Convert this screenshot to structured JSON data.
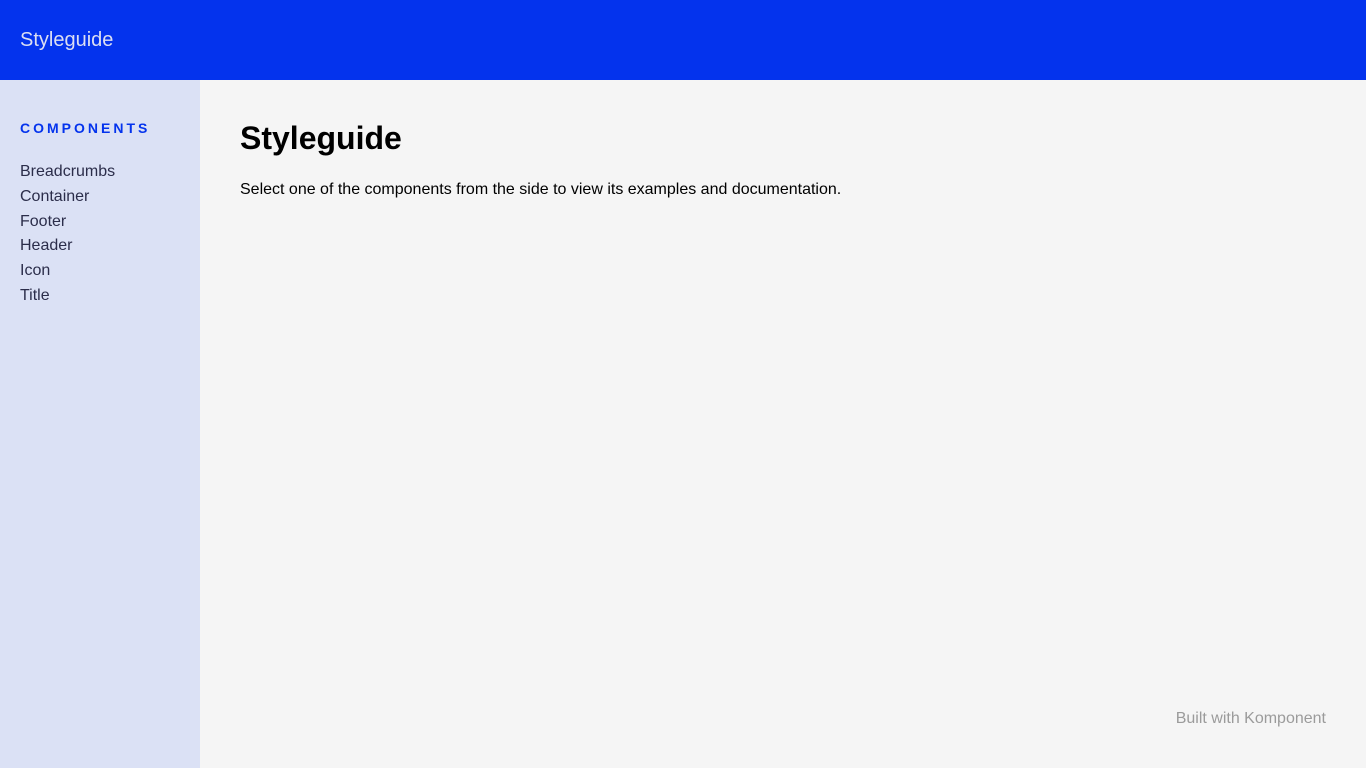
{
  "header": {
    "title": "Styleguide"
  },
  "sidebar": {
    "heading": "Components",
    "items": [
      {
        "label": "Breadcrumbs"
      },
      {
        "label": "Container"
      },
      {
        "label": "Footer"
      },
      {
        "label": "Header"
      },
      {
        "label": "Icon"
      },
      {
        "label": "Title"
      }
    ]
  },
  "main": {
    "title": "Styleguide",
    "description": "Select one of the components from the side to view its examples and documentation."
  },
  "footer": {
    "note": "Built with Komponent"
  },
  "colors": {
    "brand": "#0433ed",
    "sidebar": "#dbe1f5",
    "background": "#f5f5f5"
  }
}
